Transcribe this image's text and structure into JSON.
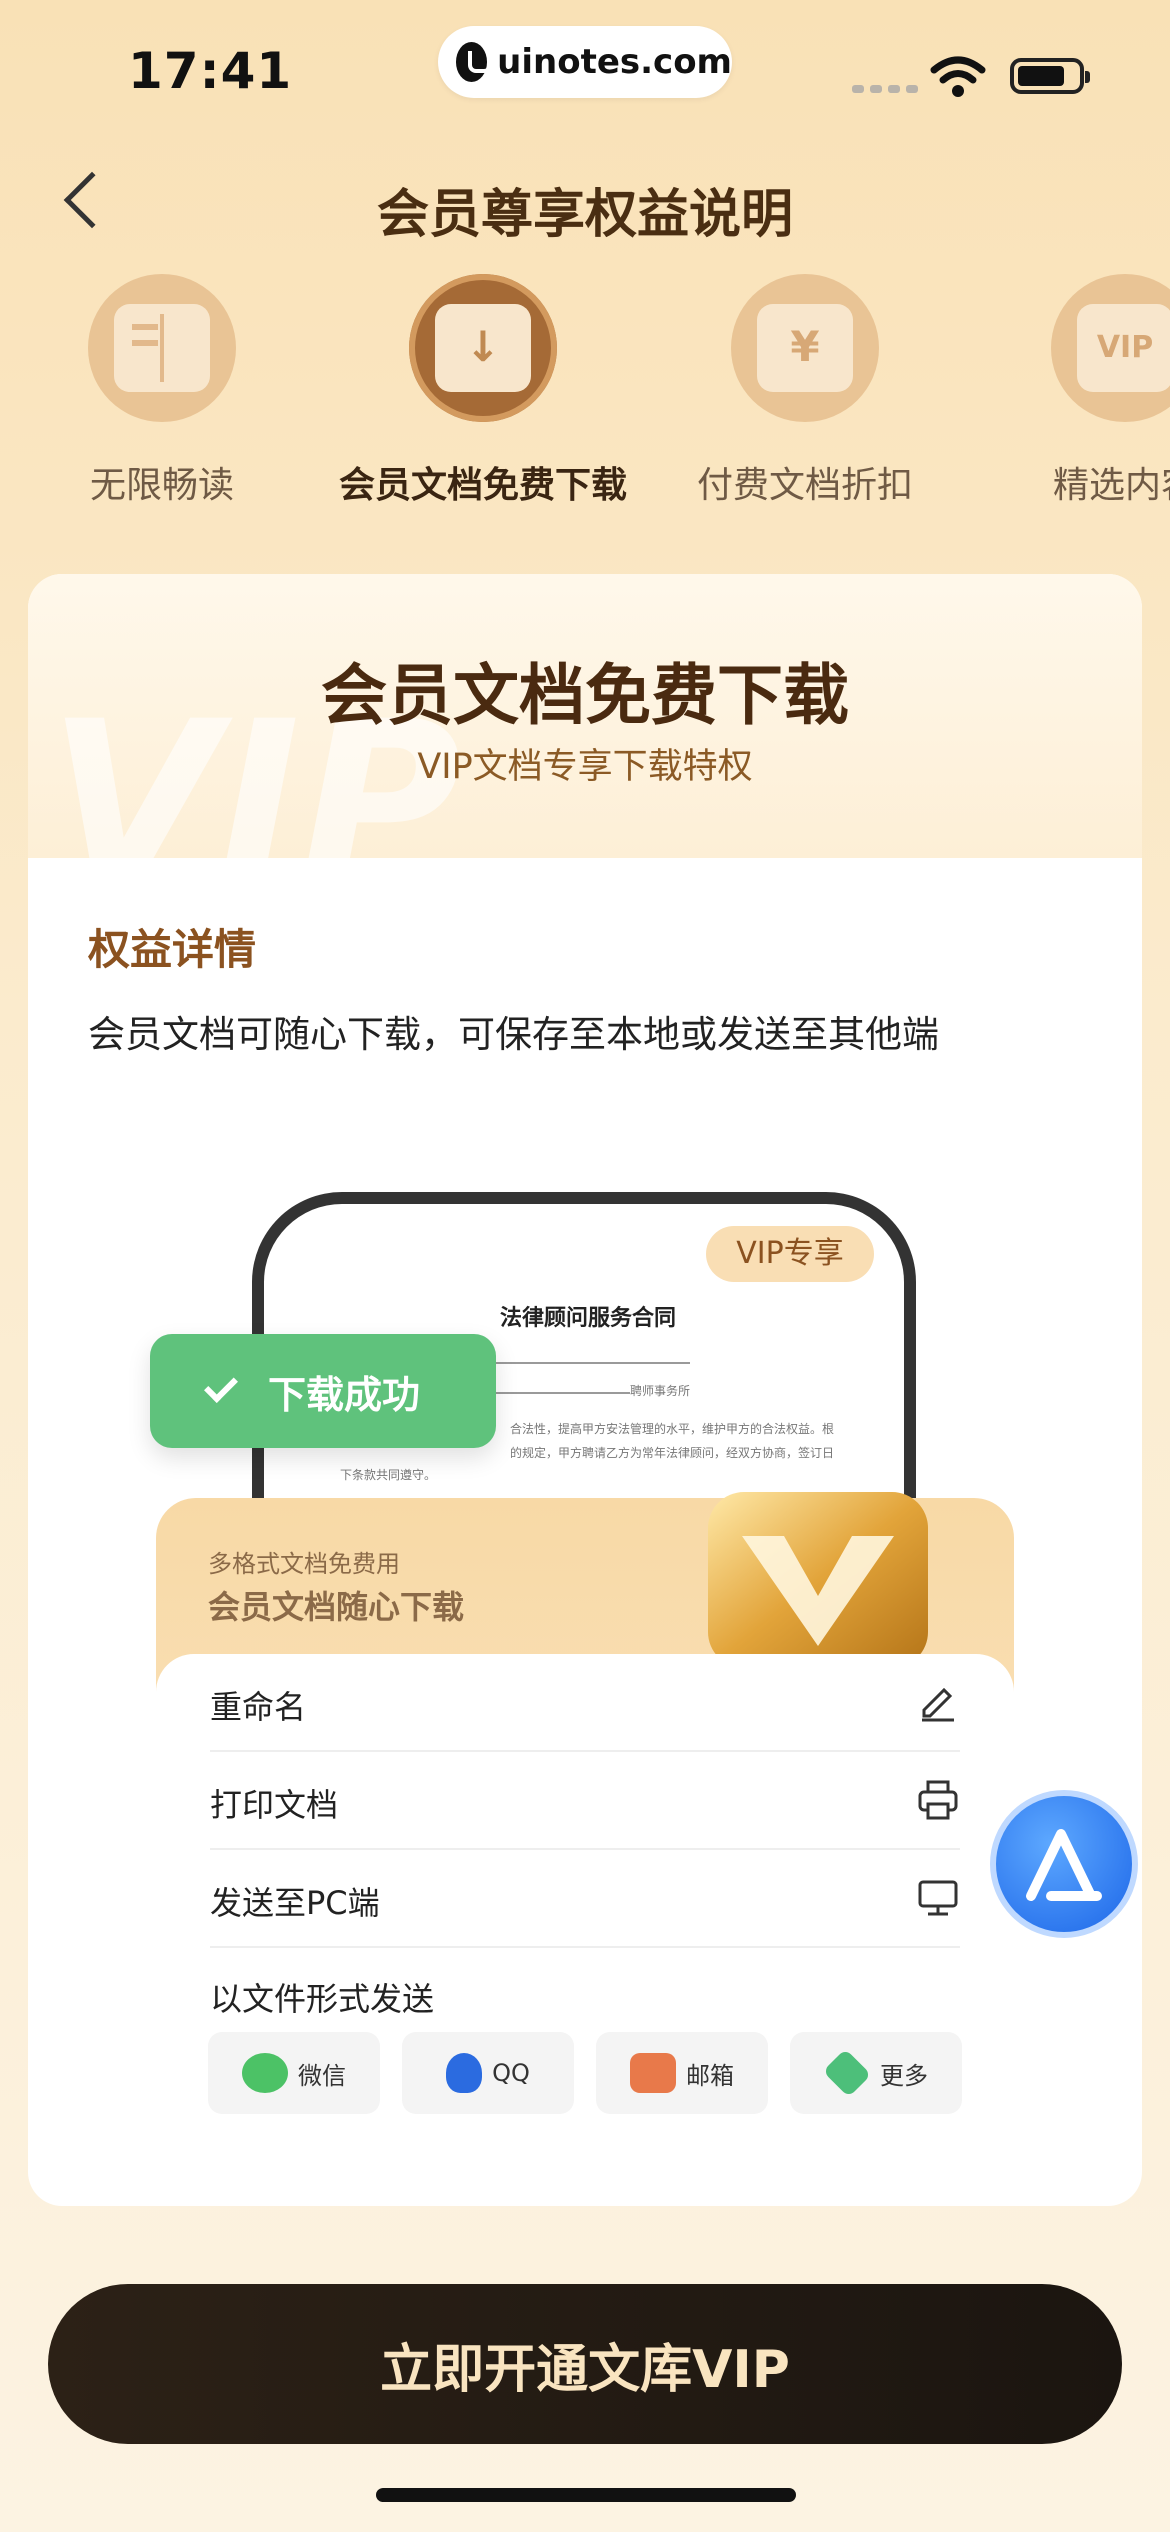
{
  "status_bar": {
    "time": "17:41",
    "url": "uinotes.com"
  },
  "nav": {
    "back_icon": "chevron-left-icon",
    "title": "会员尊享权益说明"
  },
  "benefit_tabs": [
    {
      "label": "无限畅读",
      "icon": "book-icon",
      "active": false
    },
    {
      "label": "会员文档免费下载",
      "icon": "download-document-icon",
      "active": true
    },
    {
      "label": "付费文档折扣",
      "icon": "yen-document-icon",
      "active": false
    },
    {
      "label": "精选内容",
      "icon": "vip-card-icon",
      "active": false
    }
  ],
  "card": {
    "title": "会员文档免费下载",
    "subtitle": "VIP文档专享下载特权",
    "watermark": "VIP",
    "detail_title": "权益详情",
    "detail_text": "会员文档可随心下载，可保存至本地或发送至其他端"
  },
  "illustration": {
    "vip_badge": "VIP专享",
    "doc_title": "法律顾问服务合同",
    "doc_fragment_1": "聘师事务所",
    "doc_fragment_2": "合法性，提高甲方安法管理的水平，维护甲方的合法权益。根",
    "doc_fragment_3": "的规定，甲方聘请乙方为常年法律顾问，经双方协商，签订日",
    "doc_fragment_4": "下条款共同遵守。",
    "success_text": "下载成功",
    "panel_small": "多格式文档免费用",
    "panel_main": "会员文档随心下载",
    "menu": [
      {
        "label": "重命名",
        "icon": "edit-icon"
      },
      {
        "label": "打印文档",
        "icon": "printer-icon"
      },
      {
        "label": "发送至PC端",
        "icon": "monitor-icon"
      }
    ],
    "share_label": "以文件形式发送",
    "share_buttons": [
      {
        "label": "微信",
        "icon": "wechat-icon",
        "color": "#4CC266"
      },
      {
        "label": "QQ",
        "icon": "qq-icon",
        "color": "#2B6BE0"
      },
      {
        "label": "邮箱",
        "icon": "mail-icon",
        "color": "#E8794A"
      },
      {
        "label": "更多",
        "icon": "layers-icon",
        "color": "#4DBF7A"
      }
    ]
  },
  "cta": {
    "label": "立即开通文库VIP"
  }
}
